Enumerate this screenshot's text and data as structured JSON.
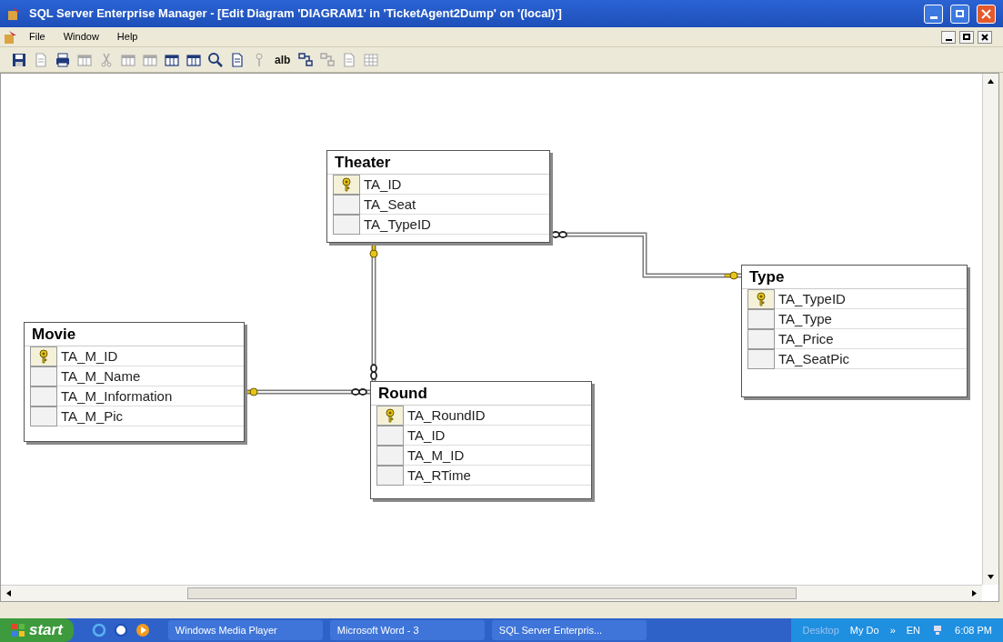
{
  "window": {
    "title": "SQL Server Enterprise Manager - [Edit Diagram 'DIAGRAM1' in 'TicketAgent2Dump' on '(local)']"
  },
  "menu": [
    "File",
    "Window",
    "Help"
  ],
  "toolbar": [
    {
      "kind": "save",
      "disabled": false
    },
    {
      "kind": "document",
      "disabled": true
    },
    {
      "kind": "print",
      "disabled": false
    },
    {
      "kind": "table",
      "disabled": true
    },
    {
      "kind": "cut",
      "disabled": true
    },
    {
      "kind": "copy",
      "disabled": true
    },
    {
      "kind": "paste",
      "disabled": true
    },
    {
      "kind": "table",
      "disabled": false
    },
    {
      "kind": "table",
      "disabled": false
    },
    {
      "kind": "zoom",
      "disabled": false
    },
    {
      "kind": "document",
      "disabled": false
    },
    {
      "kind": "key",
      "disabled": true
    },
    {
      "kind": "text",
      "label": "alb",
      "disabled": false
    },
    {
      "kind": "diagram",
      "disabled": false
    },
    {
      "kind": "diagram",
      "disabled": true
    },
    {
      "kind": "document",
      "disabled": true
    },
    {
      "kind": "grid",
      "disabled": true
    }
  ],
  "tables": [
    {
      "name": "Theater",
      "columns": [
        {
          "name": "TA_ID",
          "primary_key": true
        },
        {
          "name": "TA_Seat",
          "primary_key": false
        },
        {
          "name": "TA_TypeID",
          "primary_key": false
        }
      ]
    },
    {
      "name": "Type",
      "columns": [
        {
          "name": "TA_TypeID",
          "primary_key": true
        },
        {
          "name": "TA_Type",
          "primary_key": false
        },
        {
          "name": "TA_Price",
          "primary_key": false
        },
        {
          "name": "TA_SeatPic",
          "primary_key": false
        }
      ]
    },
    {
      "name": "Movie",
      "columns": [
        {
          "name": "TA_M_ID",
          "primary_key": true
        },
        {
          "name": "TA_M_Name",
          "primary_key": false
        },
        {
          "name": "TA_M_Information",
          "primary_key": false
        },
        {
          "name": "TA_M_Pic",
          "primary_key": false
        }
      ]
    },
    {
      "name": "Round",
      "columns": [
        {
          "name": "TA_RoundID",
          "primary_key": true
        },
        {
          "name": "TA_ID",
          "primary_key": false
        },
        {
          "name": "TA_M_ID",
          "primary_key": false
        },
        {
          "name": "TA_RTime",
          "primary_key": false
        }
      ]
    }
  ],
  "taskbar": {
    "start": "start",
    "tasks": [
      "Windows Media Player",
      "Microsoft Word - 3",
      "SQL Server Enterpris..."
    ],
    "desktop": "Desktop",
    "my_documents": "My Do",
    "more": "»",
    "language": "EN",
    "clock": "6:08 PM"
  }
}
